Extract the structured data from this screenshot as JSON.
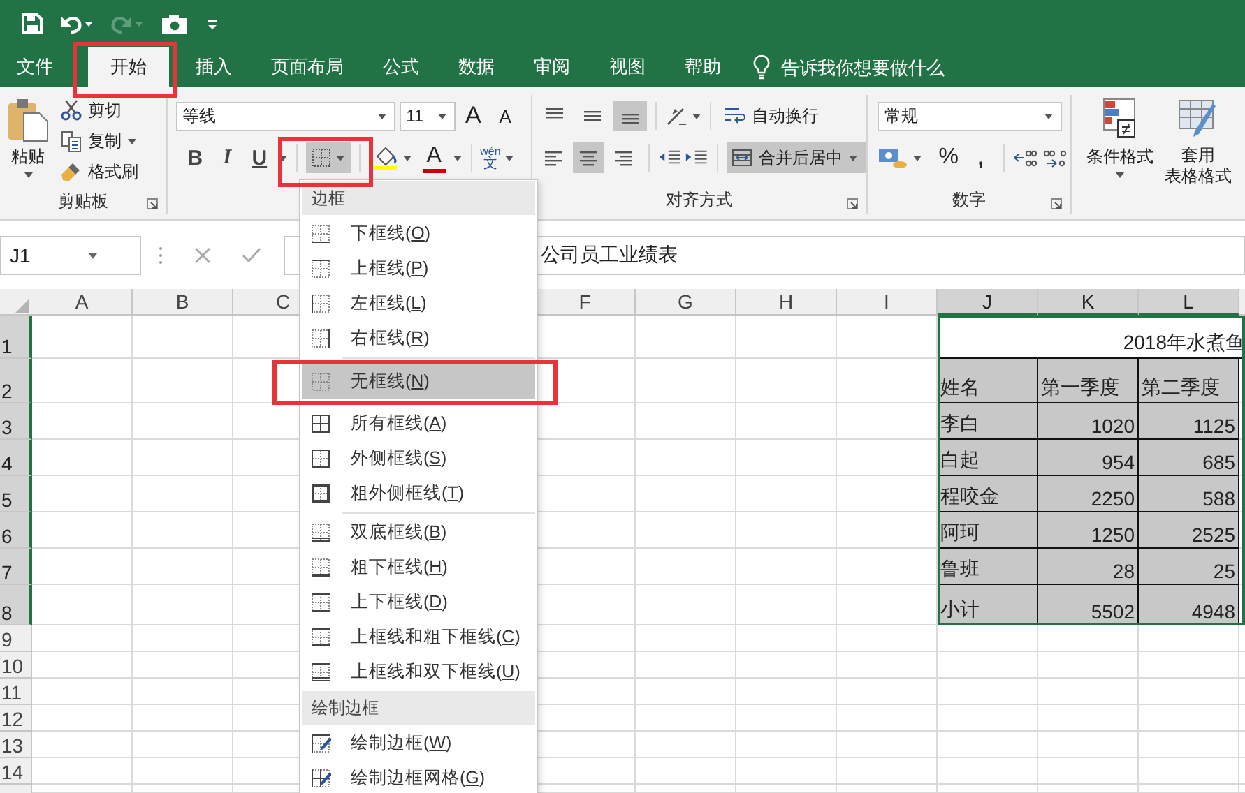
{
  "title_bar": {
    "quick_access": [
      {
        "kind": "save",
        "disabled": false
      },
      {
        "kind": "undo",
        "disabled": false
      },
      {
        "kind": "redo",
        "disabled": true
      },
      {
        "kind": "camera",
        "disabled": false
      },
      {
        "kind": "customize",
        "disabled": false
      }
    ]
  },
  "menu_tabs": [
    {
      "label": "文件",
      "selected": false,
      "highlighted": false
    },
    {
      "label": "开始",
      "selected": true,
      "highlighted": true
    },
    {
      "label": "插入",
      "selected": false,
      "highlighted": false
    },
    {
      "label": "页面布局",
      "selected": false,
      "highlighted": false
    },
    {
      "label": "公式",
      "selected": false,
      "highlighted": false
    },
    {
      "label": "数据",
      "selected": false,
      "highlighted": false
    },
    {
      "label": "审阅",
      "selected": false,
      "highlighted": false
    },
    {
      "label": "视图",
      "selected": false,
      "highlighted": false
    },
    {
      "label": "帮助",
      "selected": false,
      "highlighted": false
    }
  ],
  "tell_me": "告诉我你想要做什么",
  "ribbon": {
    "clipboard": {
      "label": "剪贴板",
      "paste": "粘贴",
      "commands": [
        {
          "kind": "cut",
          "label": "剪切"
        },
        {
          "kind": "copy",
          "label": "复制"
        },
        {
          "kind": "format-painter",
          "label": "格式刷"
        }
      ]
    },
    "font": {
      "name": "等线",
      "size": "11",
      "grow": "A",
      "shrink": "A",
      "styles": [
        {
          "kind": "bold",
          "label": "B"
        },
        {
          "kind": "italic",
          "label": "I"
        },
        {
          "kind": "underline",
          "label": "U"
        }
      ],
      "border_button": {
        "open": true,
        "highlighted": true
      },
      "font_color": "A",
      "phonetic": [
        "wén",
        "文"
      ]
    },
    "alignment": {
      "label": "对齐方式",
      "vertical": [
        {
          "kind": "top",
          "selected": false
        },
        {
          "kind": "middle",
          "selected": false
        },
        {
          "kind": "bottom",
          "selected": true
        }
      ],
      "horizontal": [
        {
          "kind": "left",
          "selected": false
        },
        {
          "kind": "center",
          "selected": true
        },
        {
          "kind": "right",
          "selected": false
        }
      ],
      "wrap": "自动换行",
      "merge": {
        "label": "合并后居中",
        "selected": true
      }
    },
    "number": {
      "label": "数字",
      "format": "常规",
      "percent": "%",
      "comma": ","
    },
    "styles": {
      "conditional": "条件格式",
      "table_format": [
        "套用",
        "表格格式"
      ]
    }
  },
  "formula_bar": {
    "name_box": "J1",
    "formula": "公司员工业绩表"
  },
  "sheet": {
    "columns": [
      {
        "label": "A",
        "selected": false
      },
      {
        "label": "B",
        "selected": false
      },
      {
        "label": "C",
        "selected": false
      },
      {
        "label": "F",
        "selected": false
      },
      {
        "label": "G",
        "selected": false
      },
      {
        "label": "H",
        "selected": false
      },
      {
        "label": "I",
        "selected": false
      },
      {
        "label": "J",
        "selected": true
      },
      {
        "label": "K",
        "selected": true
      },
      {
        "label": "L",
        "selected": true
      }
    ],
    "rows": [
      {
        "label": "1",
        "selected": true
      },
      {
        "label": "2",
        "selected": true
      },
      {
        "label": "3",
        "selected": true
      },
      {
        "label": "4",
        "selected": true
      },
      {
        "label": "5",
        "selected": true
      },
      {
        "label": "6",
        "selected": true
      },
      {
        "label": "7",
        "selected": true
      },
      {
        "label": "8",
        "selected": true
      },
      {
        "label": "9",
        "selected": false
      },
      {
        "label": "10",
        "selected": false
      },
      {
        "label": "11",
        "selected": false
      },
      {
        "label": "12",
        "selected": false
      },
      {
        "label": "13",
        "selected": false
      },
      {
        "label": "14",
        "selected": false
      }
    ],
    "table": {
      "title": "2018年水煮鱼",
      "rows": [
        [
          "姓名",
          "第一季度",
          "第二季度"
        ],
        [
          "李白",
          "1020",
          "1125"
        ],
        [
          "白起",
          "954",
          "685"
        ],
        [
          "程咬金",
          "2250",
          "588"
        ],
        [
          "阿珂",
          "1250",
          "2525"
        ],
        [
          "鲁班",
          "28",
          "25"
        ],
        [
          "小计",
          "5502",
          "4948"
        ]
      ]
    }
  },
  "border_menu": {
    "sections": [
      {
        "title": "边框",
        "groups": [
          [
            {
              "kind": "bottom",
              "label": "下框线(O)",
              "selected": false,
              "highlighted": false
            },
            {
              "kind": "top",
              "label": "上框线(P)",
              "selected": false,
              "highlighted": false
            },
            {
              "kind": "left",
              "label": "左框线(L)",
              "selected": false,
              "highlighted": false
            },
            {
              "kind": "right",
              "label": "右框线(R)",
              "selected": false,
              "highlighted": false
            }
          ],
          [
            {
              "kind": "none",
              "label": "无框线(N)",
              "selected": true,
              "highlighted": true
            },
            {
              "kind": "all",
              "label": "所有框线(A)",
              "selected": false,
              "highlighted": false
            },
            {
              "kind": "outside",
              "label": "外侧框线(S)",
              "selected": false,
              "highlighted": false
            },
            {
              "kind": "thick-outside",
              "label": "粗外侧框线(T)",
              "selected": false,
              "highlighted": false
            }
          ],
          [
            {
              "kind": "double-bottom",
              "label": "双底框线(B)",
              "selected": false,
              "highlighted": false
            },
            {
              "kind": "thick-bottom",
              "label": "粗下框线(H)",
              "selected": false,
              "highlighted": false
            },
            {
              "kind": "top-bottom",
              "label": "上下框线(D)",
              "selected": false,
              "highlighted": false
            },
            {
              "kind": "top-thick-bottom",
              "label": "上框线和粗下框线(C)",
              "selected": false,
              "highlighted": false
            },
            {
              "kind": "top-double-bottom",
              "label": "上框线和双下框线(U)",
              "selected": false,
              "highlighted": false
            }
          ]
        ]
      },
      {
        "title": "绘制边框",
        "groups": [
          [
            {
              "kind": "draw",
              "label": "绘制边框(W)",
              "selected": false,
              "highlighted": false
            },
            {
              "kind": "draw-grid",
              "label": "绘制边框网格(G)",
              "selected": false,
              "highlighted": false
            }
          ]
        ]
      }
    ]
  }
}
